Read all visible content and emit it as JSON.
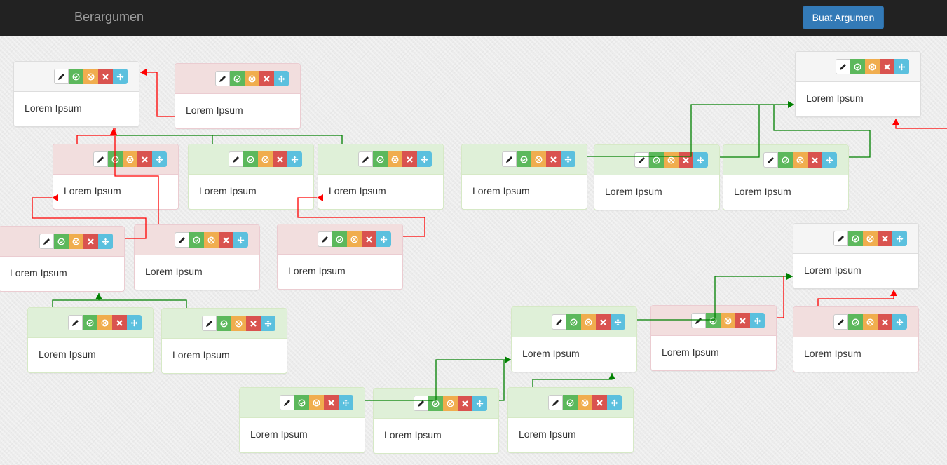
{
  "navbar": {
    "brand": "Berargumen",
    "create_button": "Buat Argumen"
  },
  "toolbar_icons": [
    "pencil-icon",
    "check-circle-icon",
    "ban-circle-icon",
    "remove-icon",
    "move-icon"
  ],
  "colors": {
    "neutral_head": "#f5f5f5",
    "support_head": "#dff0d8",
    "attack_head": "#f2dede",
    "support_link": "#008000",
    "attack_link": "#ff0000",
    "accept": "#5cb85c",
    "neutralize": "#f0ad4e",
    "delete": "#d9534f",
    "move": "#5bc0de"
  },
  "nodes": [
    {
      "id": "n1",
      "type": "neutral",
      "text": "Lorem Ipsum"
    },
    {
      "id": "n2",
      "type": "attack",
      "text": "Lorem Ipsum"
    },
    {
      "id": "n3",
      "type": "attack",
      "text": "Lorem Ipsum"
    },
    {
      "id": "n4",
      "type": "support",
      "text": "Lorem Ipsum"
    },
    {
      "id": "n5",
      "type": "support",
      "text": "Lorem Ipsum"
    },
    {
      "id": "n6",
      "type": "support",
      "text": "Lorem Ipsum"
    },
    {
      "id": "n7",
      "type": "support",
      "text": "Lorem Ipsum"
    },
    {
      "id": "n8",
      "type": "support",
      "text": "Lorem Ipsum"
    },
    {
      "id": "n9",
      "type": "neutral",
      "text": "Lorem Ipsum"
    },
    {
      "id": "n10",
      "type": "attack",
      "text": "Lorem Ipsum"
    },
    {
      "id": "n11",
      "type": "attack",
      "text": "Lorem Ipsum"
    },
    {
      "id": "n12",
      "type": "attack",
      "text": "Lorem Ipsum"
    },
    {
      "id": "n13",
      "type": "neutral",
      "text": "Lorem Ipsum"
    },
    {
      "id": "n14",
      "type": "support",
      "text": "Lorem Ipsum"
    },
    {
      "id": "n15",
      "type": "support",
      "text": "Lorem Ipsum"
    },
    {
      "id": "n16",
      "type": "support",
      "text": "Lorem Ipsum"
    },
    {
      "id": "n17",
      "type": "attack",
      "text": "Lorem Ipsum"
    },
    {
      "id": "n18",
      "type": "attack",
      "text": "Lorem Ipsum"
    },
    {
      "id": "n19",
      "type": "support",
      "text": "Lorem Ipsum"
    },
    {
      "id": "n20",
      "type": "support",
      "text": "Lorem Ipsum"
    },
    {
      "id": "n21",
      "type": "support",
      "text": "Lorem Ipsum"
    }
  ],
  "links": [
    {
      "from": "n2",
      "to": "n1",
      "type": "attack"
    },
    {
      "from": "n3",
      "to": "n1",
      "type": "attack"
    },
    {
      "from": "n4",
      "to": "n1",
      "type": "support"
    },
    {
      "from": "n5",
      "to": "n1",
      "type": "support"
    },
    {
      "from": "n10",
      "to": "n3",
      "type": "attack"
    },
    {
      "from": "n11",
      "to": "n1",
      "type": "attack"
    },
    {
      "from": "n12",
      "to": "n5",
      "type": "attack"
    },
    {
      "from": "n14",
      "to": "n10",
      "type": "support"
    },
    {
      "from": "n15",
      "to": "n10",
      "type": "support"
    },
    {
      "from": "n6",
      "to": "n9",
      "type": "support"
    },
    {
      "from": "n7",
      "to": "n9",
      "type": "support"
    },
    {
      "from": "n8",
      "to": "n9",
      "type": "support"
    },
    {
      "from": "external",
      "to": "n9",
      "type": "attack"
    },
    {
      "from": "n19",
      "to": "n16",
      "type": "support"
    },
    {
      "from": "n20",
      "to": "n16",
      "type": "support"
    },
    {
      "from": "n21",
      "to": "n16",
      "type": "support"
    },
    {
      "from": "n16",
      "to": "n13",
      "type": "support"
    },
    {
      "from": "n17",
      "to": "n13",
      "type": "attack"
    },
    {
      "from": "n18",
      "to": "n13",
      "type": "attack"
    }
  ]
}
